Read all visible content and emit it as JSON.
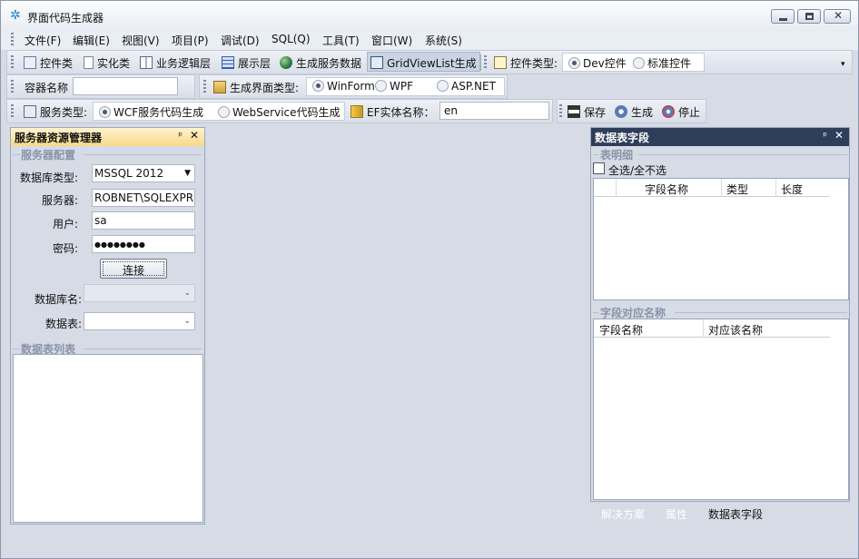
{
  "window": {
    "title": "界面代码生成器",
    "icon": "gear-icon",
    "controls": {
      "minimize": "minimize-icon",
      "maximize": "maximize-icon",
      "close": "✕"
    }
  },
  "menu": [
    "文件(F)",
    "编辑(E)",
    "视图(V)",
    "项目(P)",
    "调试(D)",
    "SQL(Q)",
    "工具(T)",
    "窗口(W)",
    "系统(S)"
  ],
  "toolbar1": {
    "items": [
      "控件类",
      "实化类",
      "业务逻辑层",
      "展示层",
      "生成服务数据",
      "GridViewList生成"
    ],
    "control_type_label": "控件类型:",
    "control_type_options": [
      "Dev控件",
      "标准控件"
    ],
    "overflow": "▾"
  },
  "toolbar2": {
    "container_label": "容器名称",
    "container_value": "",
    "ui_type_label": "生成界面类型:",
    "ui_type_options": [
      "WinForm",
      "WPF",
      "ASP.NET"
    ]
  },
  "toolbar3": {
    "service_type_label": "服务类型:",
    "service_options": [
      "WCF服务代码生成",
      "WebService代码生成"
    ],
    "ef_label": "EF实体名称：",
    "ef_value": "en",
    "save": "保存",
    "generate": "生成",
    "stop": "停止"
  },
  "left_panel": {
    "title": "服务器资源管理器",
    "pin": "ᵖ",
    "close": "✕",
    "server_config": {
      "title": "服务器配置",
      "db_type_label": "数据库类型:",
      "db_type_value": "MSSQL 2012",
      "server_label": "服务器:",
      "server_value": "ROBNET\\SQLEXPRESS",
      "user_label": "用户:",
      "user_value": "sa",
      "password_label": "密码:",
      "password_value": "●●●●●●●●",
      "connect": "连接",
      "db_name_label": "数据库名:",
      "db_name_value": "",
      "table_label": "数据表:",
      "table_value": ""
    },
    "table_list": {
      "title": "数据表列表"
    }
  },
  "right_panel": {
    "title": "数据表字段",
    "pin": "ᵖ",
    "close": "✕",
    "detail": {
      "title": "表明细",
      "select_all": "全选/全不选",
      "columns": [
        "",
        "字段名称",
        "类型",
        "长度"
      ]
    },
    "mapping": {
      "title": "字段对应名称",
      "columns": [
        "字段名称",
        "对应该名称"
      ]
    }
  },
  "bottom_tabs": [
    "解决方案",
    "属性",
    "数据表字段"
  ],
  "colors": {
    "workspace": "#2b3a56",
    "panel": "#d6dbe6",
    "accent": "#1e7fd0"
  }
}
